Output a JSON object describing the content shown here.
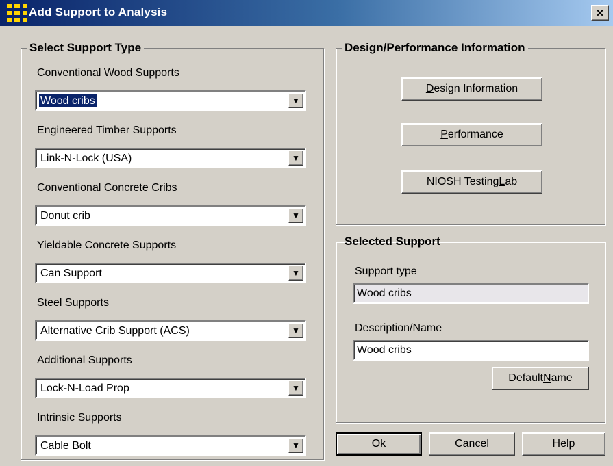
{
  "window": {
    "title": "Add Support to Analysis",
    "close_glyph": "×",
    "icon": "app-icon"
  },
  "select_support_type": {
    "legend": "Select Support Type",
    "groups": [
      {
        "label": "Conventional Wood Supports",
        "value": "Wood cribs",
        "selected": true
      },
      {
        "label": "Engineered Timber Supports",
        "value": "Link-N-Lock (USA)"
      },
      {
        "label": "Conventional Concrete Cribs",
        "value": "Donut crib"
      },
      {
        "label": "Yieldable Concrete Supports",
        "value": "Can Support"
      },
      {
        "label": "Steel Supports",
        "value": "Alternative Crib Support (ACS)"
      },
      {
        "label": "Additional Supports",
        "value": "Lock-N-Load Prop"
      },
      {
        "label": "Intrinsic Supports",
        "value": "Cable Bolt"
      }
    ],
    "arrow_glyph": "▼"
  },
  "design_performance": {
    "legend": "Design/Performance Information",
    "design_btn": {
      "before": "",
      "mnemonic": "D",
      "after": "esign Information"
    },
    "performance_btn": {
      "before": "",
      "mnemonic": "P",
      "after": "erformance"
    },
    "niosh_btn": {
      "before": "NIOSH Testing ",
      "mnemonic": "L",
      "after": "ab"
    }
  },
  "selected_support": {
    "legend": "Selected Support",
    "type_label": "Support type",
    "type_value": "Wood cribs",
    "desc_label": "Description/Name",
    "desc_value": "Wood cribs",
    "default_btn": {
      "before": "Default ",
      "mnemonic": "N",
      "after": "ame"
    }
  },
  "footer": {
    "ok_btn": {
      "before": "",
      "mnemonic": "O",
      "after": "k"
    },
    "cancel_btn": {
      "before": "",
      "mnemonic": "C",
      "after": "ancel"
    },
    "help_btn": {
      "before": "",
      "mnemonic": "H",
      "after": "elp"
    }
  },
  "colors": {
    "titlebar_start": "#0a246a",
    "titlebar_end": "#a6caf0",
    "dialog_bg": "#d4d0c8",
    "selection": "#0a246a"
  }
}
